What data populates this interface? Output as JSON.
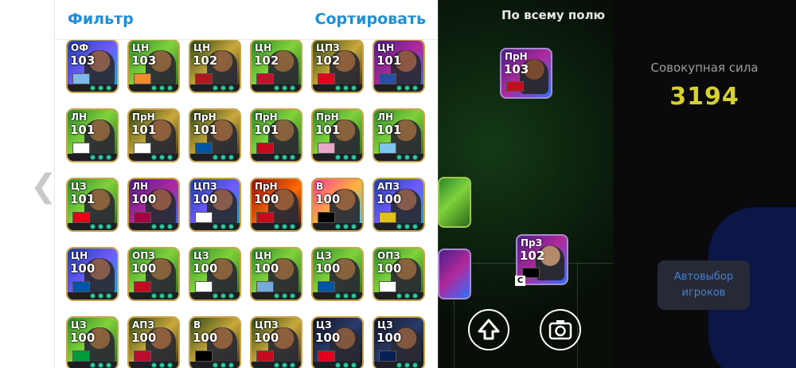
{
  "header": {
    "filter_label": "Фильтр",
    "sort_label": "Сортировать"
  },
  "pitch": {
    "title": "По всему полю"
  },
  "info": {
    "strength_label": "Совокупная сила",
    "strength_value": "3194",
    "auto_select_label": "Автовыбор игроков"
  },
  "captain_marker": "C",
  "players": [
    {
      "pos": "ОФ",
      "rating": "103",
      "bg": "bg-blue",
      "flag": "#7fb8ea"
    },
    {
      "pos": "ЦН",
      "rating": "103",
      "bg": "bg-green",
      "flag": "#f48b2c"
    },
    {
      "pos": "ЦН",
      "rating": "102",
      "bg": "bg-gold",
      "flag": "#b0181f"
    },
    {
      "pos": "ЦН",
      "rating": "102",
      "bg": "bg-green",
      "flag": "#c8102e"
    },
    {
      "pos": "ЦПЗ",
      "rating": "102",
      "bg": "bg-gold",
      "flag": "#e3001b"
    },
    {
      "pos": "ЦН",
      "rating": "101",
      "bg": "bg-purple",
      "flag": "#2a4ea1"
    },
    {
      "pos": "ЛН",
      "rating": "101",
      "bg": "bg-green",
      "flag": "#ffffff"
    },
    {
      "pos": "ПрН",
      "rating": "101",
      "bg": "bg-gold",
      "flag": "#ffffff"
    },
    {
      "pos": "ПрН",
      "rating": "101",
      "bg": "bg-gold",
      "flag": "#0055a4"
    },
    {
      "pos": "ПрН",
      "rating": "101",
      "bg": "bg-green",
      "flag": "#c60b1e"
    },
    {
      "pos": "ПрН",
      "rating": "101",
      "bg": "bg-green",
      "flag": "#e7a7c8"
    },
    {
      "pos": "ЛН",
      "rating": "101",
      "bg": "bg-green",
      "flag": "#7ec6f0"
    },
    {
      "pos": "ЦЗ",
      "rating": "101",
      "bg": "bg-green",
      "flag": "#e3001b"
    },
    {
      "pos": "ЛН",
      "rating": "100",
      "bg": "bg-purple",
      "flag": "#a50044"
    },
    {
      "pos": "ЦПЗ",
      "rating": "100",
      "bg": "bg-blue",
      "flag": "#ffffff"
    },
    {
      "pos": "ПрН",
      "rating": "100",
      "bg": "bg-red",
      "flag": "#c60b1e"
    },
    {
      "pos": "В",
      "rating": "100",
      "bg": "bg-pink",
      "flag": "#000000"
    },
    {
      "pos": "АПЗ",
      "rating": "100",
      "bg": "bg-blue",
      "flag": "#e0c11b"
    },
    {
      "pos": "ЦН",
      "rating": "100",
      "bg": "bg-blue",
      "flag": "#0055a4"
    },
    {
      "pos": "ОПЗ",
      "rating": "100",
      "bg": "bg-green",
      "flag": "#c60b1e"
    },
    {
      "pos": "ЦЗ",
      "rating": "100",
      "bg": "bg-green",
      "flag": "#ffffff"
    },
    {
      "pos": "ЦН",
      "rating": "100",
      "bg": "bg-green",
      "flag": "#75aadb"
    },
    {
      "pos": "ЦЗ",
      "rating": "100",
      "bg": "bg-green",
      "flag": "#0055a4"
    },
    {
      "pos": "ОПЗ",
      "rating": "100",
      "bg": "bg-green",
      "flag": "#ffffff"
    },
    {
      "pos": "ЦЗ",
      "rating": "100",
      "bg": "bg-green",
      "flag": "#009c3b"
    },
    {
      "pos": "АПЗ",
      "rating": "100",
      "bg": "bg-gold",
      "flag": "#ba0c2f"
    },
    {
      "pos": "В",
      "rating": "100",
      "bg": "bg-gold",
      "flag": "#000000"
    },
    {
      "pos": "ЦПЗ",
      "rating": "100",
      "bg": "bg-gold",
      "flag": "#c60b1e"
    },
    {
      "pos": "ЦЗ",
      "rating": "100",
      "bg": "bg-dark",
      "flag": "#e3001b"
    },
    {
      "pos": "ЦЗ",
      "rating": "100",
      "bg": "bg-dark",
      "flag": "#0a1f55"
    }
  ],
  "pitch_players": [
    {
      "pos": "ПрН",
      "rating": "103",
      "flag": "#c60b1e"
    },
    {
      "pos": "ПрЗ",
      "rating": "102",
      "flag": "#000000"
    }
  ]
}
